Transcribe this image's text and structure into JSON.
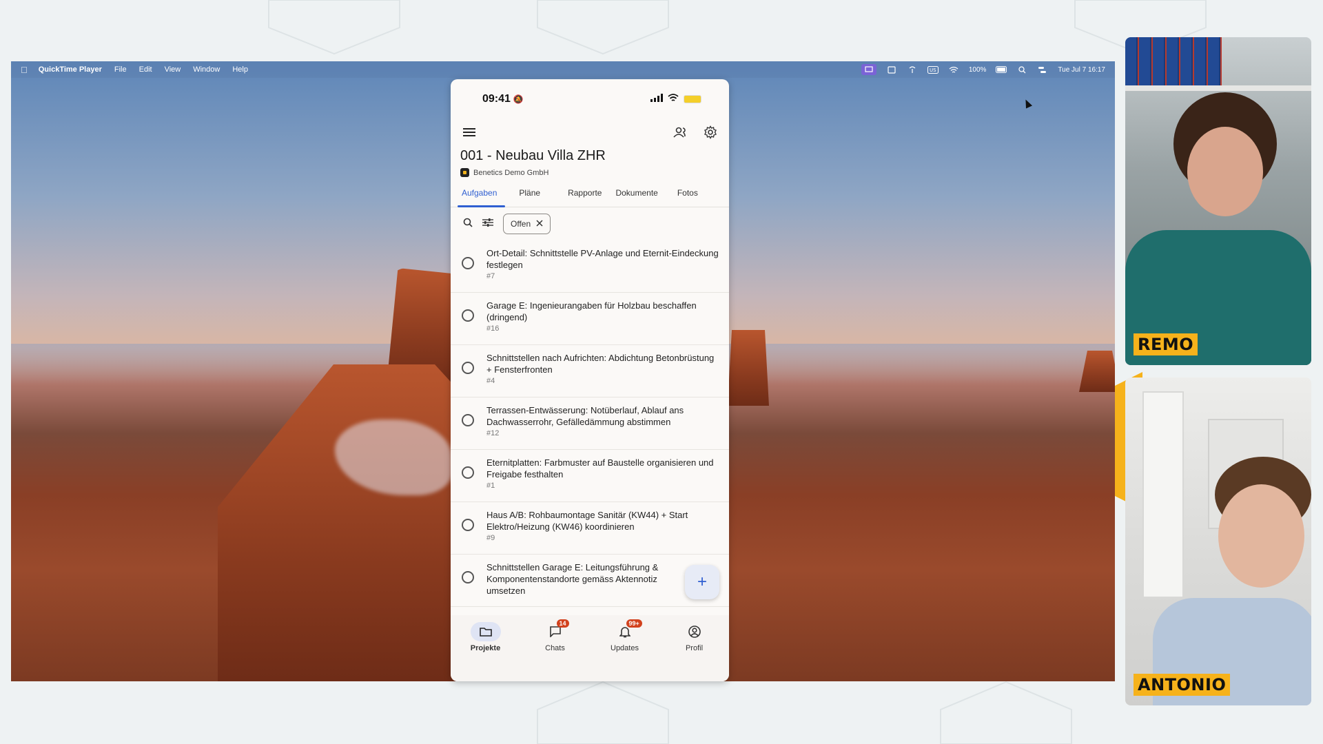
{
  "menubar": {
    "app_name": "QuickTime Player",
    "menus": [
      "File",
      "Edit",
      "View",
      "Window",
      "Help"
    ],
    "battery": "100%",
    "datetime": "Tue Jul 7  16:17"
  },
  "phone": {
    "status_time": "09:41",
    "project_title": "001 - Neubau Villa ZHR",
    "company": "Benetics Demo GmbH",
    "tabs": [
      "Aufgaben",
      "Pläne",
      "Rapporte",
      "Dokumente",
      "Fotos"
    ],
    "active_tab": "Aufgaben",
    "filter_chip": "Offen",
    "tasks": [
      {
        "title": "Ort-Detail: Schnittstelle PV-Anlage und Eternit-Eindeckung festlegen",
        "num": "#7"
      },
      {
        "title": "Garage E: Ingenieurangaben für Holzbau beschaffen (dringend)",
        "num": "#16"
      },
      {
        "title": "Schnittstellen nach Aufrichten: Abdichtung Betonbrüstung + Fensterfronten",
        "num": "#4"
      },
      {
        "title": "Terrassen-Entwässerung: Notüberlauf, Ablauf ans Dachwasserrohr, Gefälledämmung abstimmen",
        "num": "#12"
      },
      {
        "title": "Eternitplatten: Farbmuster auf Baustelle organisieren und Freigabe festhalten",
        "num": "#1"
      },
      {
        "title": "Haus A/B: Rohbaumontage Sanitär (KW44) + Start Elektro/Heizung (KW46) koordinieren",
        "num": "#9"
      },
      {
        "title": "Schnittstellen Garage E: Leitungsführung & Komponentenstandorte gemäss Aktennotiz umsetzen",
        "num": ""
      }
    ],
    "fab_label": "+",
    "nav": [
      {
        "label": "Projekte",
        "badge": ""
      },
      {
        "label": "Chats",
        "badge": "14"
      },
      {
        "label": "Updates",
        "badge": "99+"
      },
      {
        "label": "Profil",
        "badge": ""
      }
    ]
  },
  "participants": {
    "top": "REMO",
    "bottom": "ANTONIO"
  },
  "colors": {
    "accent": "#2f5fd1",
    "badge": "#d2411d",
    "nametag": "#f6b21b"
  }
}
